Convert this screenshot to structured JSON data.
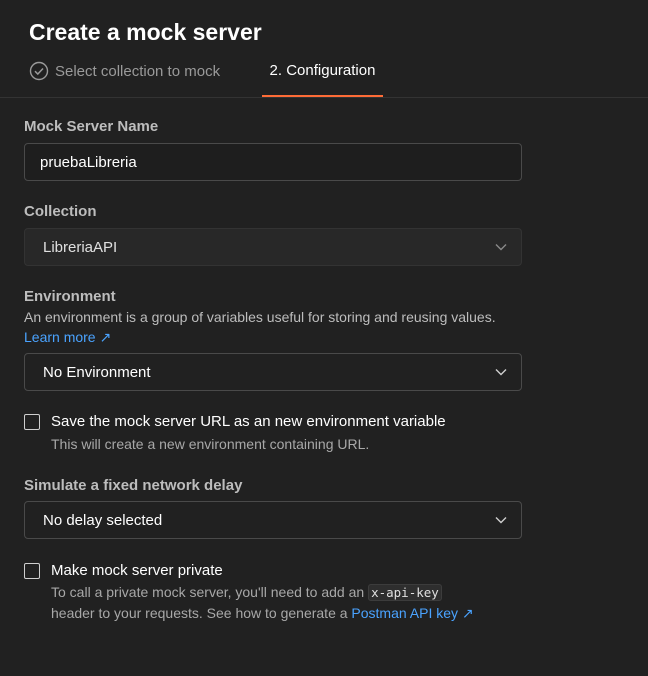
{
  "header": {
    "title": "Create a mock server",
    "steps": [
      {
        "label": "Select collection to mock",
        "status": "done",
        "icon": "check-circle-icon"
      },
      {
        "label": "2. Configuration",
        "status": "active"
      }
    ]
  },
  "form": {
    "mock_name": {
      "label": "Mock Server Name",
      "value": "pruebaLibreria"
    },
    "collection": {
      "label": "Collection",
      "value": "LibreriaAPI",
      "icon": "chevron-down-icon"
    },
    "environment": {
      "label": "Environment",
      "help": "An environment is a group of variables useful for storing and reusing values.",
      "learn_more": "Learn more ↗",
      "value": "No Environment",
      "icon": "chevron-down-icon"
    },
    "save_url": {
      "label": "Save the mock server URL as an new environment variable",
      "help": "This will create a new environment containing URL.",
      "checked": false
    },
    "delay": {
      "label": "Simulate a fixed network delay",
      "value": "No delay selected",
      "icon": "chevron-down-icon"
    },
    "private": {
      "label": "Make mock server private",
      "help_before": "To call a private mock server, you'll need to add an",
      "code": "x-api-key",
      "help_after": "header to your requests. See how to generate a",
      "link": "Postman API key ↗",
      "checked": false
    }
  },
  "colors": {
    "accent": "#ff6c37",
    "link": "#4aa3ff",
    "background": "#212121"
  }
}
